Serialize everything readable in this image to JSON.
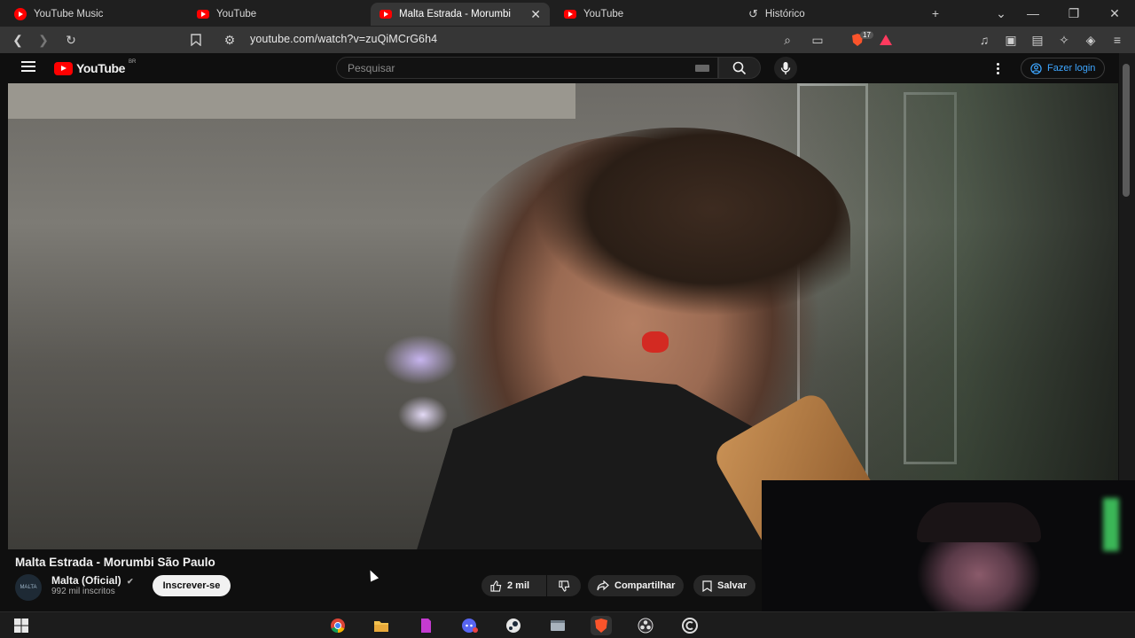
{
  "browser": {
    "tabs": [
      {
        "title": "YouTube Music",
        "icon": "youtube-music-icon",
        "active": false
      },
      {
        "title": "YouTube",
        "icon": "youtube-icon",
        "active": false
      },
      {
        "title": "Malta Estrada - Morumbi",
        "icon": "youtube-icon",
        "active": true
      },
      {
        "title": "YouTube",
        "icon": "youtube-icon",
        "active": false
      },
      {
        "title": "Histórico",
        "icon": "history-icon",
        "active": false
      }
    ],
    "url": "youtube.com/watch?v=zuQiMCrG6h4",
    "brave_badge": "17"
  },
  "youtube": {
    "logo_text": "YouTube",
    "region": "BR",
    "search_placeholder": "Pesquisar",
    "login_label": "Fazer login"
  },
  "video": {
    "title": "Malta Estrada - Morumbi São Paulo",
    "channel_name": "Malta (Oficial)",
    "subscribers": "992 mil inscritos",
    "avatar_text": "MALTA",
    "subscribe_label": "Inscrever-se",
    "likes": "2 mil",
    "share_label": "Compartilhar",
    "save_label": "Salvar"
  },
  "colors": {
    "accent_red": "#ff0000",
    "login_blue": "#3ea6ff",
    "background": "#0f0f0f"
  }
}
